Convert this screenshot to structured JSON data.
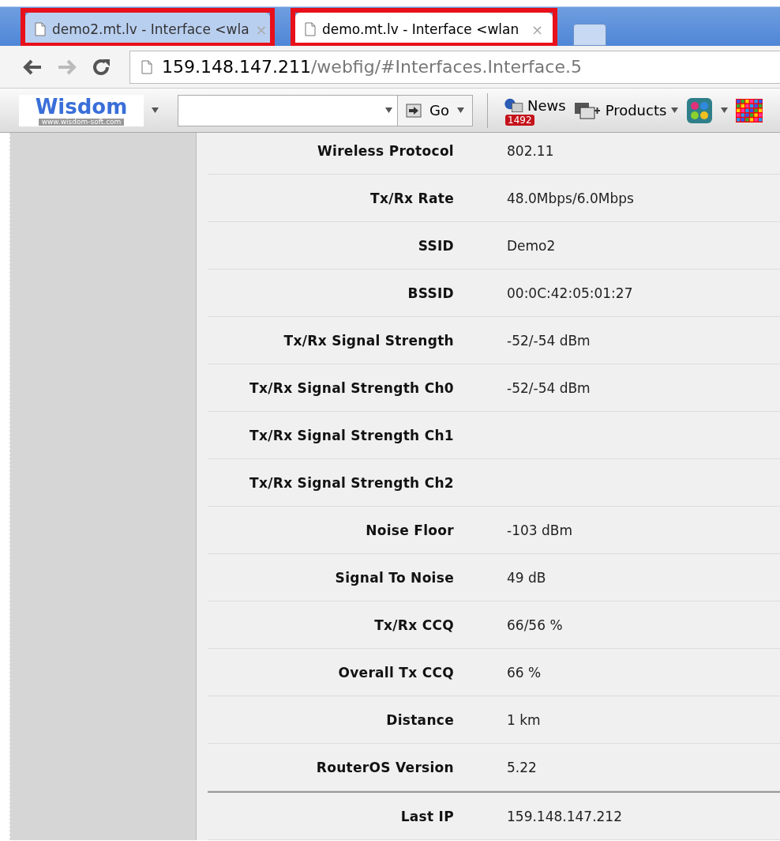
{
  "tabs": [
    {
      "title": "demo2.mt.lv - Interface <wla",
      "selected": false,
      "highlighted": true,
      "close": "×"
    },
    {
      "title": "demo.mt.lv - Interface <wlan",
      "selected": true,
      "highlighted": true,
      "close": "×"
    }
  ],
  "address_bar": {
    "host": "159.148.147.211",
    "path": "/webfig/#Interfaces.Interface.5"
  },
  "toolbar": {
    "logo": "Wisdom",
    "logo_url": "www.wisdom-soft.com",
    "go_button": "Go",
    "news": "News",
    "news_badge": "1492",
    "products": "Products"
  },
  "sections": [
    {
      "rows": [
        {
          "label": "Wireless Protocol",
          "value": "802.11"
        },
        {
          "label": "Tx/Rx Rate",
          "value": "48.0Mbps/6.0Mbps"
        },
        {
          "label": "SSID",
          "value": "Demo2"
        },
        {
          "label": "BSSID",
          "value": "00:0C:42:05:01:27"
        },
        {
          "label": "Tx/Rx Signal Strength",
          "value": "-52/-54 dBm"
        },
        {
          "label": "Tx/Rx Signal Strength Ch0",
          "value": "-52/-54 dBm"
        },
        {
          "label": "Tx/Rx Signal Strength Ch1"
        },
        {
          "label": "Tx/Rx Signal Strength Ch2"
        },
        {
          "label": "Noise Floor",
          "value": "-103 dBm"
        },
        {
          "label": "Signal To Noise",
          "value": "49 dB"
        },
        {
          "label": "Tx/Rx CCQ",
          "value": "66/56 %"
        },
        {
          "label": "Overall Tx CCQ",
          "value": "66 %"
        },
        {
          "label": "Distance",
          "value": "1 km"
        },
        {
          "label": "RouterOS Version",
          "value": "5.22"
        }
      ]
    },
    {
      "rows": [
        {
          "label": "Last IP",
          "value": "159.148.147.212"
        }
      ]
    }
  ]
}
